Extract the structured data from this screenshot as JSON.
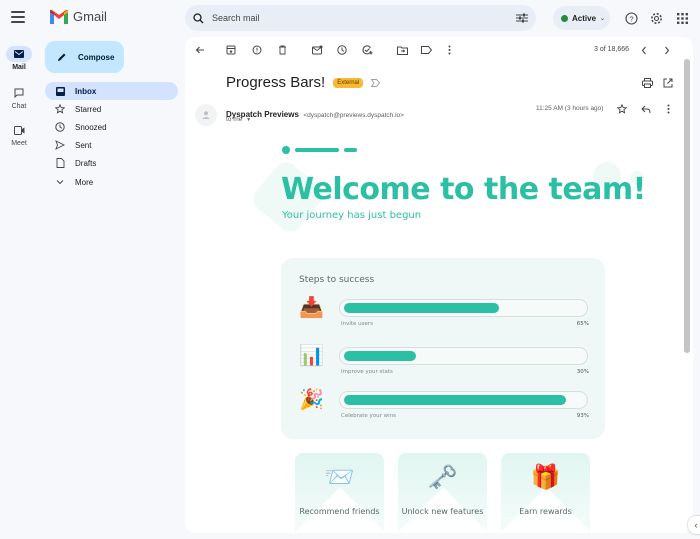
{
  "app": {
    "name": "Gmail"
  },
  "rail": {
    "items": [
      {
        "label": "Mail",
        "icon": "mail-icon",
        "active": true
      },
      {
        "label": "Chat",
        "icon": "chat-icon",
        "active": false
      },
      {
        "label": "Meet",
        "icon": "video-icon",
        "active": false
      }
    ]
  },
  "search": {
    "placeholder": "Search mail"
  },
  "status": {
    "label": "Active",
    "color": "#1e8e3e"
  },
  "compose": {
    "label": "Compose"
  },
  "nav": {
    "items": [
      {
        "label": "Inbox",
        "icon": "inbox-icon",
        "active": true
      },
      {
        "label": "Starred",
        "icon": "star-icon"
      },
      {
        "label": "Snoozed",
        "icon": "clock-icon"
      },
      {
        "label": "Sent",
        "icon": "send-icon"
      },
      {
        "label": "Drafts",
        "icon": "draft-icon"
      },
      {
        "label": "More",
        "icon": "chevron-down-icon"
      }
    ]
  },
  "toolbar": {
    "counter": "3 of 18,666"
  },
  "message": {
    "subject": "Progress Bars!",
    "badge": "External",
    "sender_name": "Dyspatch Previews",
    "sender_email": "<dyspatch@previews.dyspatch.io>",
    "recipient": "to me",
    "time": "11:25 AM (3 hours ago)"
  },
  "email": {
    "headline": "Welcome to the team!",
    "subheadline": "Your journey has just begun",
    "accent_color": "#2bbfa4",
    "steps": {
      "title": "Steps to success",
      "items": [
        {
          "emoji": "📥",
          "label": "Invite users",
          "percent_text": "65%",
          "value": 0.65
        },
        {
          "emoji": "📊",
          "label": "Improve your stats",
          "percent_text": "30%",
          "value": 0.3
        },
        {
          "emoji": "🎉",
          "label": "Celebrate your wins",
          "percent_text": "93%",
          "value": 0.93
        }
      ]
    },
    "cards": [
      {
        "emoji": "📨",
        "label": "Recommend friends"
      },
      {
        "emoji": "🗝️",
        "label": "Unlock new features"
      },
      {
        "emoji": "🎁",
        "label": "Earn rewards"
      }
    ]
  }
}
